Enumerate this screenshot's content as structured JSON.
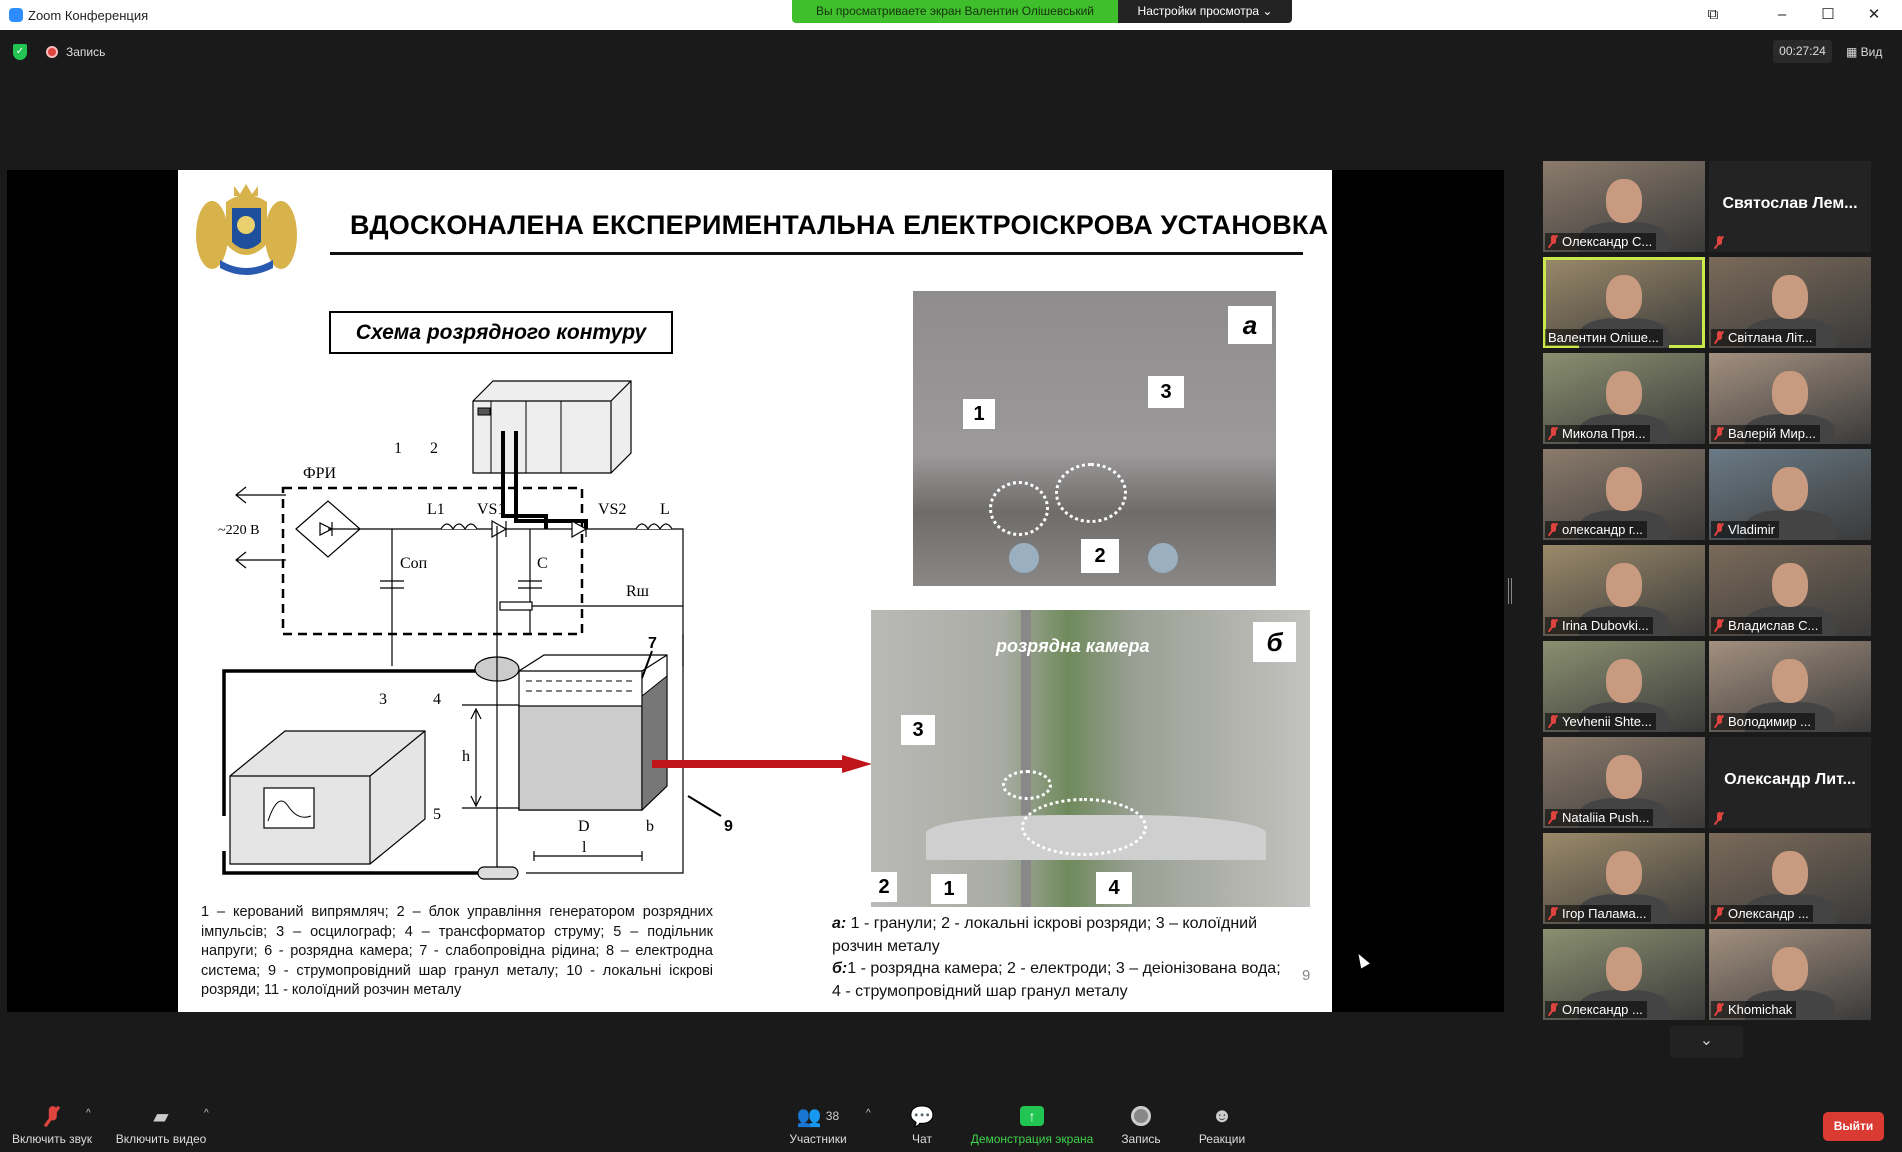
{
  "window": {
    "title": "Zoom Конференция",
    "banner": "Вы просматриваете экран Валентин Олішевський",
    "view_settings": "Настройки просмотра ⌄",
    "controls": [
      "⧉",
      "–",
      "☐",
      "✕"
    ]
  },
  "topbar": {
    "recording": "Запись",
    "timer": "00:27:24",
    "view": "Вид"
  },
  "slide": {
    "title": "ВДОСКОНАЛЕНА ЕКСПЕРИМЕНТАЛЬНА ЕЛЕКТРОІСКРОВА УСТАНОВКА",
    "schema_label": "Схема розрядного контуру",
    "diagram": {
      "fri": "ФРИ",
      "v220": "~220 В",
      "l1": "L1",
      "vs1": "VS1",
      "vs2": "VS2",
      "l": "L",
      "cop": "Cоп",
      "c": "C",
      "rsh": "Rш",
      "n1": "1",
      "n2": "2",
      "n3": "3",
      "n4": "4",
      "n5": "5",
      "n7": "7",
      "n9": "9",
      "h": "h",
      "d": "D",
      "len": "l",
      "b": "b"
    },
    "photo_a": {
      "letter": "а",
      "labels": [
        "1",
        "2",
        "3"
      ]
    },
    "photo_b": {
      "letter": "б",
      "caption": "розрядна камера",
      "labels": [
        "1",
        "2",
        "3",
        "4"
      ]
    },
    "legend_left": "1 – керований випрямляч; 2 – блок управління генератором розрядних імпульсів; 3 – осцилограф; 4 – трансформатор струму; 5 – подільник напруги; 6 - розрядна камера; 7 - слабопровідна рідина; 8 – електродна система; 9 - струмопровідний шар гранул металу; 10 - локальні іскрові розряди; 11 - колоїдний розчин металу",
    "legend_right_a_key": "а:",
    "legend_right_a": " 1 - гранули; 2 - локальні іскрові розряди; 3 – колоїдний розчин металу",
    "legend_right_b_key": "б:",
    "legend_right_b": "1 - розрядна камера; 2 - електроди; 3 – деіонізована вода; 4 - струмопровідний шар гранул металу",
    "page_number": "9"
  },
  "gallery": [
    {
      "name": "Олександр С...",
      "video": true,
      "muted": true
    },
    {
      "name": "Святослав Лем...",
      "video": false,
      "muted": true
    },
    {
      "name": "Валентин Оліше...",
      "video": true,
      "muted": false,
      "active_speaker": true
    },
    {
      "name": "Світлана Літ...",
      "video": true,
      "muted": true
    },
    {
      "name": "Микола Пря...",
      "video": true,
      "muted": true
    },
    {
      "name": "Валерій Мир...",
      "video": true,
      "muted": true
    },
    {
      "name": "олександр г...",
      "video": true,
      "muted": true
    },
    {
      "name": "Vladimir",
      "video": true,
      "muted": true
    },
    {
      "name": "Irina Dubovki...",
      "video": true,
      "muted": true
    },
    {
      "name": "Владислав С...",
      "video": true,
      "muted": true
    },
    {
      "name": "Yevhenii Shte...",
      "video": true,
      "muted": true
    },
    {
      "name": "Володимир ...",
      "video": true,
      "muted": true
    },
    {
      "name": "Nataliia Push...",
      "video": true,
      "muted": true
    },
    {
      "name": "Олександр Лит...",
      "video": false,
      "muted": true
    },
    {
      "name": "Ігор Палама...",
      "video": true,
      "muted": true
    },
    {
      "name": "Олександр ...",
      "video": true,
      "muted": true
    },
    {
      "name": "Олександр ...",
      "video": true,
      "muted": true
    },
    {
      "name": "Khomichak",
      "video": true,
      "muted": true
    }
  ],
  "toolbar": {
    "unmute": "Включить звук",
    "video": "Включить видео",
    "participants": "Участники",
    "participants_count": "38",
    "chat": "Чат",
    "share": "Демонстрация экрана",
    "record": "Запись",
    "reactions": "Реакции",
    "leave": "Выйти"
  },
  "colors": {
    "share_green": "#3fbf2b",
    "leave_red": "#d93a32",
    "active_speaker": "#c9e84a"
  }
}
